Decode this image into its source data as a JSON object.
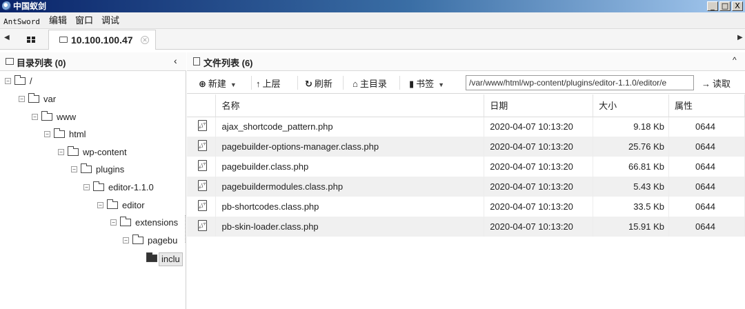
{
  "window": {
    "title": "中国蚁剑",
    "btn_min": "_",
    "btn_max": "□",
    "btn_close": "X"
  },
  "menu": {
    "items": [
      "AntSword",
      "编辑",
      "窗口",
      "调试"
    ]
  },
  "tabs": {
    "active_label": "10.100.100.47",
    "left_arrow": "◀",
    "right_arrow": "▶"
  },
  "left_panel": {
    "title": "目录列表 (0)",
    "collapse": "‹",
    "tree": [
      {
        "label": "/",
        "exp": "−"
      },
      {
        "label": "var",
        "exp": "−"
      },
      {
        "label": "www",
        "exp": "−"
      },
      {
        "label": "html",
        "exp": "−"
      },
      {
        "label": "wp-content",
        "exp": "−"
      },
      {
        "label": "plugins",
        "exp": "−"
      },
      {
        "label": "editor-1.1.0",
        "exp": "−"
      },
      {
        "label": "editor",
        "exp": "−"
      },
      {
        "label": "extensions",
        "exp": "−"
      },
      {
        "label": "pagebu",
        "exp": "−"
      },
      {
        "label": "inclu",
        "exp": ""
      }
    ]
  },
  "right_panel": {
    "title": "文件列表 (6)",
    "collapse": "^",
    "toolbar": {
      "new": "新建",
      "up": "上层",
      "refresh": "刷新",
      "home": "主目录",
      "bookmark": "书签",
      "path": "/var/www/html/wp-content/plugins/editor-1.1.0/editor/e",
      "read": "读取"
    },
    "columns": [
      "名称",
      "日期",
      "大小",
      "属性"
    ],
    "files": [
      {
        "name": "ajax_shortcode_pattern.php",
        "date": "2020-04-07 10:13:20",
        "size": "9.18 Kb",
        "attr": "0644"
      },
      {
        "name": "pagebuilder-options-manager.class.php",
        "date": "2020-04-07 10:13:20",
        "size": "25.76 Kb",
        "attr": "0644"
      },
      {
        "name": "pagebuilder.class.php",
        "date": "2020-04-07 10:13:20",
        "size": "66.81 Kb",
        "attr": "0644"
      },
      {
        "name": "pagebuildermodules.class.php",
        "date": "2020-04-07 10:13:20",
        "size": "5.43 Kb",
        "attr": "0644"
      },
      {
        "name": "pb-shortcodes.class.php",
        "date": "2020-04-07 10:13:20",
        "size": "33.5 Kb",
        "attr": "0644"
      },
      {
        "name": "pb-skin-loader.class.php",
        "date": "2020-04-07 10:13:20",
        "size": "15.91 Kb",
        "attr": "0644"
      }
    ]
  }
}
